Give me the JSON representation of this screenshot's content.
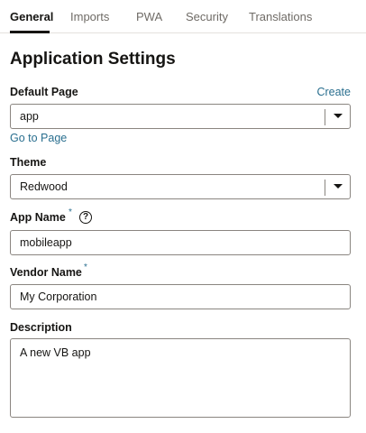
{
  "tabs": [
    {
      "label": "General",
      "active": true
    },
    {
      "label": "Imports",
      "active": false
    },
    {
      "label": "PWA",
      "active": false
    },
    {
      "label": "Security",
      "active": false
    },
    {
      "label": "Translations",
      "active": false
    }
  ],
  "page": {
    "title": "Application Settings"
  },
  "default_page": {
    "label": "Default Page",
    "create_link": "Create",
    "value": "app",
    "go_to_link": "Go to Page"
  },
  "theme": {
    "label": "Theme",
    "value": "Redwood"
  },
  "app_name": {
    "label": "App Name",
    "required_mark": "*",
    "help_icon": "question-circle-icon",
    "help_glyph": "?",
    "value": "mobileapp"
  },
  "vendor_name": {
    "label": "Vendor Name",
    "required_mark": "*",
    "value": "My Corporation"
  },
  "description": {
    "label": "Description",
    "value": "A new VB app"
  },
  "colors": {
    "link": "#2a6f8f",
    "text": "#161513",
    "border": "#8a8580"
  }
}
